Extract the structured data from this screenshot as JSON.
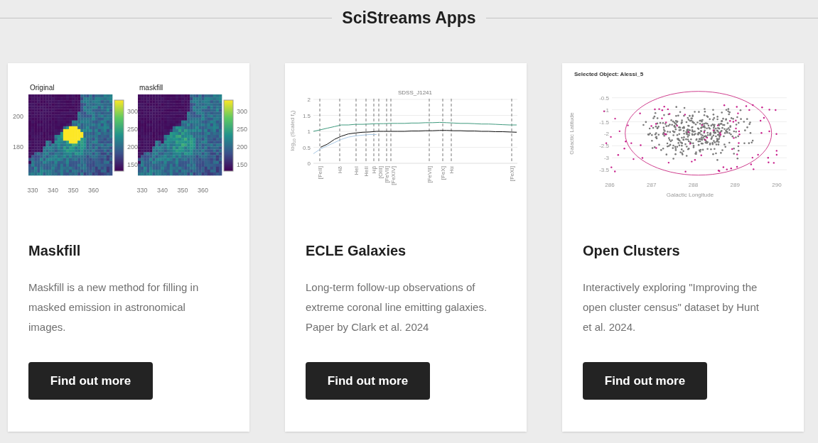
{
  "header": {
    "title": "SciStreams Apps"
  },
  "apps": [
    {
      "title": "Maskfill",
      "description": "Maskfill is a new method for filling in masked emission in astronomical images.",
      "button": "Find out more",
      "figure": {
        "kind": "heatmaps",
        "y_ticks": [
          "200",
          "180"
        ],
        "panels": [
          {
            "title": "Original",
            "bright_source": true,
            "x_ticks": [
              "330",
              "340",
              "350",
              "360"
            ],
            "colorbar_ticks": [
              "300",
              "250",
              "200",
              "150"
            ]
          },
          {
            "title": "maskfill",
            "bright_source": false,
            "x_ticks": [
              "330",
              "340",
              "350",
              "360"
            ],
            "colorbar_ticks": [
              "300",
              "250",
              "200",
              "150"
            ]
          }
        ]
      }
    },
    {
      "title": "ECLE Galaxies",
      "description": "Long-term follow-up observations of extreme coronal line emitting galaxies. Paper by Clark et al. 2024",
      "button": "Find out more",
      "figure": {
        "kind": "spectrum",
        "chart_data": {
          "type": "line",
          "title": "SDSS_J1241",
          "ylabel": "log$_{10}$ (Scaled f$_{λ}$)",
          "ylim": [
            0,
            2
          ],
          "grid": true,
          "yticks": [
            2,
            1.5,
            1,
            0.5,
            0
          ],
          "series": [
            {
              "color": "#3f9a7e",
              "values": [
                1.0,
                1.05,
                1.1,
                1.15,
                1.2,
                1.2,
                1.22,
                1.22,
                1.23,
                1.24,
                1.24,
                1.25,
                1.25,
                1.25,
                1.26,
                1.26,
                1.27,
                1.27,
                1.28,
                1.27,
                1.26,
                1.25,
                1.25,
                1.24,
                1.23,
                1.23,
                1.22,
                1.21,
                1.2,
                1.2
              ]
            },
            {
              "color": "#111111",
              "values": [
                null,
                0.5,
                0.6,
                0.75,
                0.85,
                0.92,
                0.95,
                0.97,
                0.98,
                1.0,
                1.0,
                1.0,
                1.0,
                1.0,
                1.01,
                1.01,
                1.02,
                1.02,
                1.03,
                1.03,
                1.02,
                1.02,
                1.01,
                1.01,
                1.0,
                1.0,
                0.99,
                0.99,
                0.98,
                0.97
              ]
            },
            {
              "color": "#a8c8e4",
              "values": [
                0.3,
                0.45,
                0.55,
                0.65,
                0.75,
                0.82,
                0.86,
                0.88,
                0.9,
                0.9,
                null,
                null,
                null,
                null,
                null,
                null,
                null,
                null,
                null,
                null,
                null,
                null,
                null,
                null,
                null,
                null,
                null,
                null,
                null,
                null
              ]
            }
          ]
        },
        "line_labels": [
          "[FeII]",
          "Hδ",
          "HeI",
          "HeII",
          "Hβ",
          "[OIII]",
          "[FeVII]",
          "[FeXIV]",
          "[FeVII]",
          "[FeX]",
          "Hα",
          "[FeXI]"
        ]
      }
    },
    {
      "title": "Open Clusters",
      "description": "Interactively exploring \"Improving the open cluster census\" dataset by Hunt et al. 2024.",
      "button": "Find out more",
      "figure": {
        "kind": "scatter",
        "title": "Selected Object: Alessi_5",
        "xlabel": "Galactic Longitude",
        "ylabel": "Galactic Latitude",
        "y_ticks": [
          "-0.5",
          "-1",
          "-1.5",
          "-2",
          "-2.5",
          "-3",
          "-3.5"
        ],
        "x_ticks": [
          "286",
          "287",
          "288",
          "289",
          "290"
        ]
      }
    }
  ]
}
